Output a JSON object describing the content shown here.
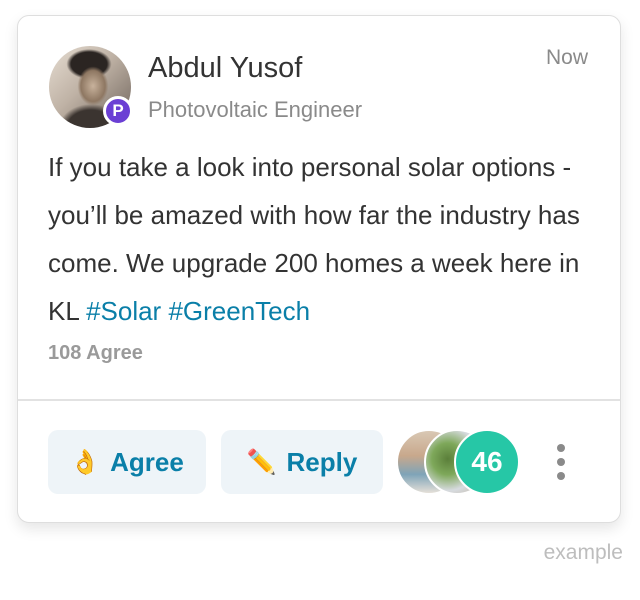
{
  "post": {
    "author_name": "Abdul Yusof",
    "author_title": "Photovoltaic Engineer",
    "badge_letter": "P",
    "timestamp": "Now",
    "body_text": "If you take a look into personal solar options - you’ll be amazed with how far the industry has come. We upgrade 200 homes a week here in KL ",
    "hashtags": [
      "#Solar",
      "#GreenTech"
    ],
    "agree_count_text": "108 Agree"
  },
  "actions": {
    "agree_label": "Agree",
    "agree_icon": "👌",
    "reply_label": "Reply",
    "reply_icon": "✏️",
    "participants_count": "46"
  },
  "footer_caption": "example",
  "colors": {
    "accent": "#0a7fa8",
    "badge": "#6b3fd4",
    "count_bubble": "#26c7a6",
    "button_bg": "#eef4f8"
  }
}
